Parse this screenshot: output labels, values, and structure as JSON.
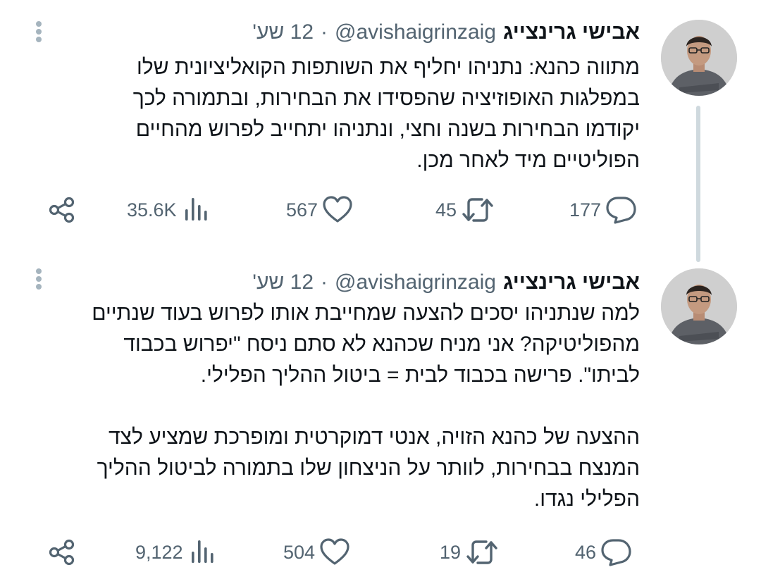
{
  "tweets": [
    {
      "author_name": "אבישי גרינצייג",
      "handle": "@avishaigrinzaig",
      "time": "12 שע'",
      "text_lines": [
        "מתווה כהנא: נתניהו יחליף את השותפות הקואליציונית שלו",
        "במפלגות האופוזיציה שהפסידו את הבחירות, ובתמורה לכך",
        "יקודמו הבחירות בשנה וחצי, ונתניהו יתחייב לפרוש מהחיים",
        "הפוליטיים מיד לאחר מכן."
      ],
      "replies": "177",
      "retweets": "45",
      "likes": "567",
      "views": "35.6K"
    },
    {
      "author_name": "אבישי גרינצייג",
      "handle": "@avishaigrinzaig",
      "time": "12 שע'",
      "text_lines": [
        "למה שנתניהו יסכים להצעה שמחייבת אותו לפרוש בעוד שנתיים",
        "מהפוליטיקה? אני מניח שכהנא לא סתם ניסח \"יפרוש בכבוד",
        "לביתו\". פרישה בכבוד לבית = ביטול ההליך הפלילי."
      ],
      "text_lines_2": [
        "ההצעה של כהנא הזויה, אנטי דמוקרטית ומופרכת שמציע לצד",
        "המנצח בבחירות, לוותר על הניצחון שלו בתמורה לביטול ההליך",
        "הפלילי נגדו."
      ],
      "replies": "46",
      "retweets": "19",
      "likes": "504",
      "views": "9,122"
    }
  ],
  "icons": {
    "reply": "reply-icon",
    "retweet": "retweet-icon",
    "like": "heart-icon",
    "views": "views-icon",
    "share": "share-icon",
    "more": "more-vertical-icon"
  },
  "colors": {
    "text": "#0f1419",
    "secondary": "#536471",
    "thread_line": "#cfd9de"
  }
}
